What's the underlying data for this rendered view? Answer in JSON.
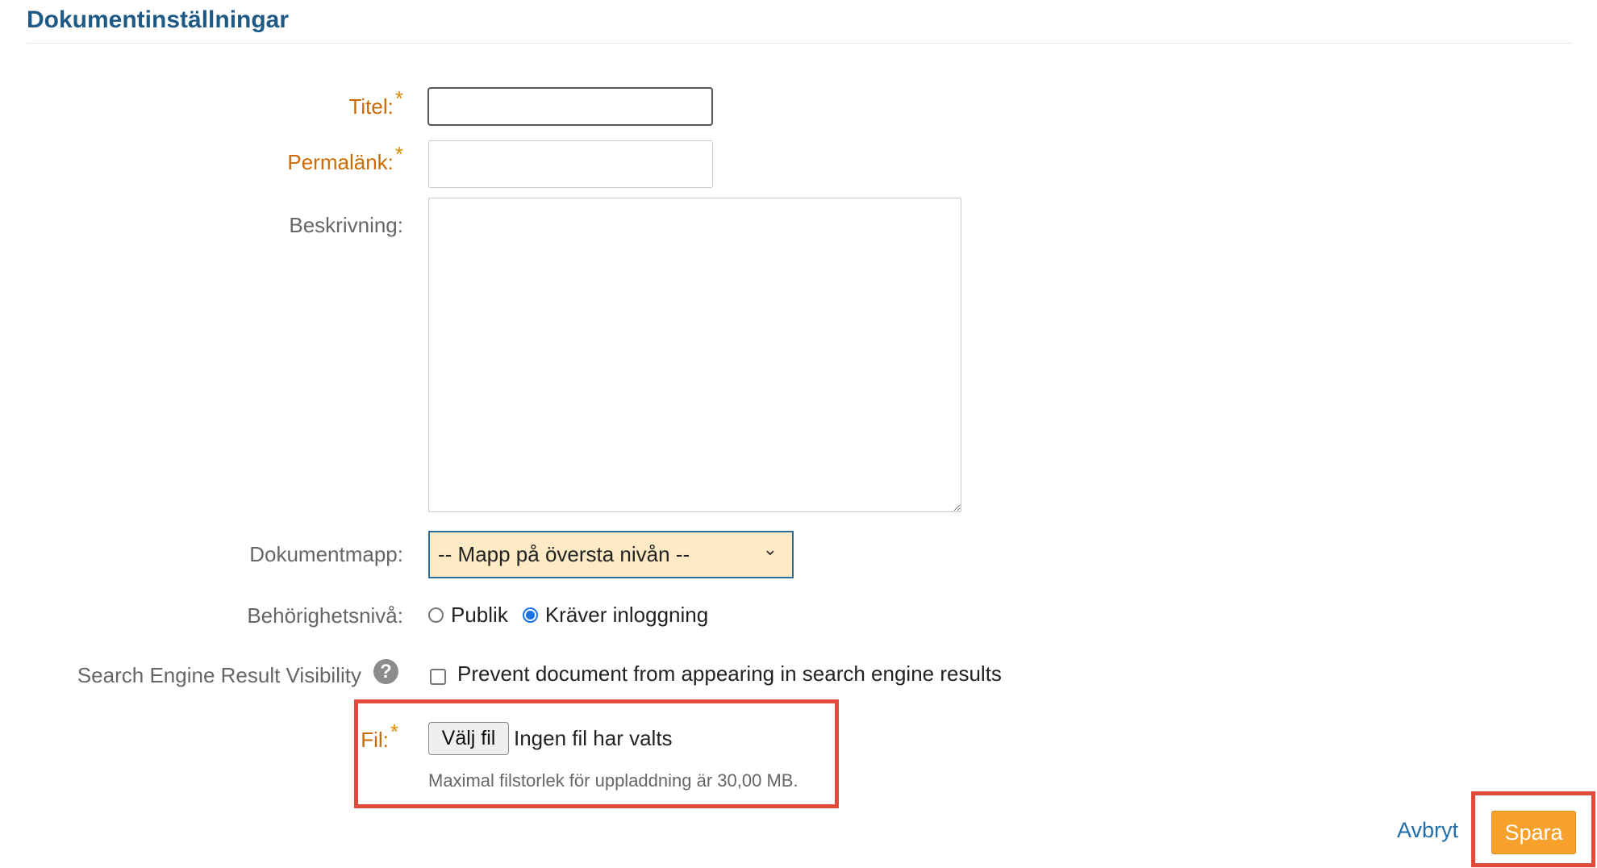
{
  "section": {
    "title": "Dokumentinställningar"
  },
  "form": {
    "title_label": "Titel:",
    "title_value": "",
    "permalink_label": "Permalänk:",
    "permalink_value": "",
    "description_label": "Beskrivning:",
    "description_value": "",
    "folder_label": "Dokumentmapp:",
    "folder_selected": "-- Mapp på översta nivån --",
    "access_label": "Behörighetsnivå:",
    "access_options": [
      {
        "label": "Publik",
        "checked": false
      },
      {
        "label": "Kräver inloggning",
        "checked": true
      }
    ],
    "seo_label": "Search Engine Result Visibility",
    "seo_checkbox_label": "Prevent document from appearing in search engine results",
    "file_label": "Fil:",
    "file_button": "Välj fil",
    "file_status": "Ingen fil har valts",
    "file_hint": "Maximal filstorlek för uppladdning är 30,00 MB.",
    "required_marker": "*"
  },
  "actions": {
    "cancel_label": "Avbryt",
    "save_label": "Spara"
  },
  "icons": {
    "help": "question-circle-icon",
    "chevron": "chevron-down-icon"
  },
  "colors": {
    "title": "#1f5a86",
    "required_label": "#cc6a00",
    "select_bg": "#feeac5",
    "save_button": "#f7a02b",
    "highlight": "#e34a3c"
  }
}
